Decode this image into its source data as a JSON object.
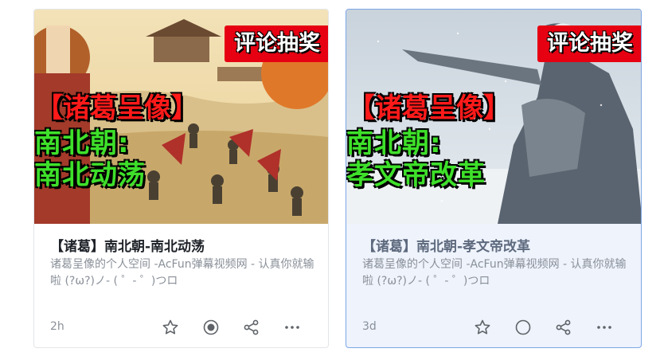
{
  "cards": [
    {
      "promo": "评论抽奖",
      "bracket": "【诸葛呈像】",
      "sub_line1": "南北朝:",
      "sub_line2": "南北动荡",
      "title": "【诸葛】南北朝-南北动荡",
      "desc": "诸葛呈像的个人空间 -AcFun弹幕视频网 - 认真你就输啦 (?ω?)ノ- ( ゜- ゜)つロ",
      "time": "2h",
      "radio_selected": true
    },
    {
      "promo": "评论抽奖",
      "bracket": "【诸葛呈像】",
      "sub_line1": "南北朝:",
      "sub_line2": "孝文帝改革",
      "title": "【诸葛】南北朝-孝文帝改革",
      "desc": "诸葛呈像的个人空间 -AcFun弹幕视频网 - 认真你就输啦 (?ω?)ノ- ( ゜- ゜)つロ",
      "time": "3d",
      "radio_selected": false
    }
  ],
  "icons": [
    "star-icon",
    "radio-icon",
    "share-icon",
    "more-icon"
  ],
  "colors": {
    "highlight_border": "#7da7e6",
    "highlight_bg": "#eef3fc",
    "promo_red": "#e60012",
    "caption_green": "#3ee02a"
  }
}
